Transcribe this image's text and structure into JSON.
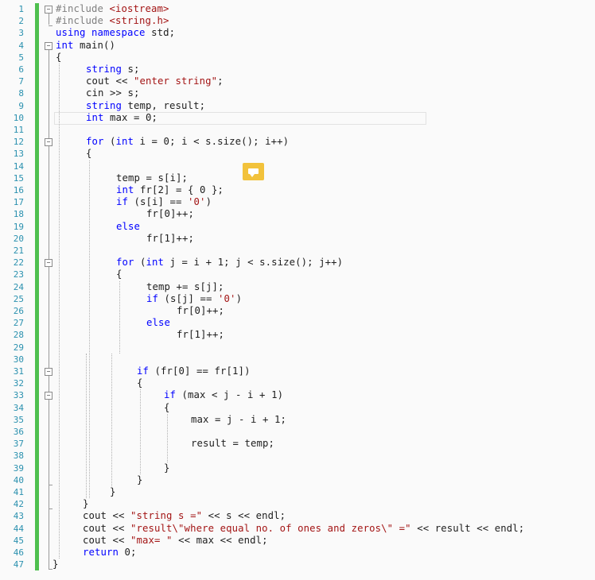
{
  "editor": {
    "line_numbers": [
      "1",
      "2",
      "3",
      "4",
      "5",
      "6",
      "7",
      "8",
      "9",
      "10",
      "11",
      "12",
      "13",
      "14",
      "15",
      "16",
      "17",
      "18",
      "19",
      "20",
      "21",
      "22",
      "23",
      "24",
      "25",
      "26",
      "27",
      "28",
      "29",
      "30",
      "31",
      "32",
      "33",
      "34",
      "35",
      "36",
      "37",
      "38",
      "39",
      "40",
      "41",
      "42",
      "43",
      "44",
      "45",
      "46",
      "47"
    ],
    "lines": [
      {
        "parts": [
          {
            "c": "inc",
            "t": "#include "
          },
          {
            "c": "str",
            "t": "<iostream>"
          }
        ]
      },
      {
        "parts": [
          {
            "c": "inc",
            "t": "#include "
          },
          {
            "c": "str",
            "t": "<string.h>"
          }
        ]
      },
      {
        "parts": [
          {
            "c": "kw",
            "t": "using namespace "
          },
          {
            "t": "std;"
          }
        ]
      },
      {
        "parts": [
          {
            "c": "kw",
            "t": "int "
          },
          {
            "t": "main()"
          }
        ]
      },
      {
        "parts": [
          {
            "t": "{"
          }
        ]
      },
      {
        "parts": [
          {
            "c": "kw",
            "t": "string "
          },
          {
            "t": "s;"
          }
        ]
      },
      {
        "parts": [
          {
            "t": "cout << "
          },
          {
            "c": "str",
            "t": "\"enter string\""
          },
          {
            "t": ";"
          }
        ]
      },
      {
        "parts": [
          {
            "t": "cin >> s;"
          }
        ]
      },
      {
        "parts": [
          {
            "c": "kw",
            "t": "string "
          },
          {
            "t": "temp, result;"
          }
        ]
      },
      {
        "parts": [
          {
            "c": "kw",
            "t": "int "
          },
          {
            "t": "max = 0;"
          }
        ]
      },
      {
        "parts": []
      },
      {
        "parts": [
          {
            "c": "kw",
            "t": "for "
          },
          {
            "t": "("
          },
          {
            "c": "kw",
            "t": "int "
          },
          {
            "t": "i = 0; i < s.size(); i++)"
          }
        ]
      },
      {
        "parts": [
          {
            "t": "{"
          }
        ]
      },
      {
        "parts": []
      },
      {
        "parts": [
          {
            "t": "temp = s[i];"
          }
        ]
      },
      {
        "parts": [
          {
            "c": "kw",
            "t": "int "
          },
          {
            "t": "fr[2] = { 0 };"
          }
        ]
      },
      {
        "parts": [
          {
            "c": "kw",
            "t": "if "
          },
          {
            "t": "(s[i] == "
          },
          {
            "c": "str",
            "t": "'0'"
          },
          {
            "t": ")"
          }
        ]
      },
      {
        "parts": [
          {
            "t": "fr[0]++;"
          }
        ]
      },
      {
        "parts": [
          {
            "c": "kw",
            "t": "else"
          }
        ]
      },
      {
        "parts": [
          {
            "t": "fr[1]++;"
          }
        ]
      },
      {
        "parts": []
      },
      {
        "parts": [
          {
            "c": "kw",
            "t": "for "
          },
          {
            "t": "("
          },
          {
            "c": "kw",
            "t": "int "
          },
          {
            "t": "j = i + 1; j < s.size(); j++)"
          }
        ]
      },
      {
        "parts": [
          {
            "t": "{"
          }
        ]
      },
      {
        "parts": [
          {
            "t": "temp += s[j];"
          }
        ]
      },
      {
        "parts": [
          {
            "c": "kw",
            "t": "if "
          },
          {
            "t": "(s[j] == "
          },
          {
            "c": "str",
            "t": "'0'"
          },
          {
            "t": ")"
          }
        ]
      },
      {
        "parts": [
          {
            "t": "fr[0]++;"
          }
        ]
      },
      {
        "parts": [
          {
            "c": "kw",
            "t": "else"
          }
        ]
      },
      {
        "parts": [
          {
            "t": "fr[1]++;"
          }
        ]
      },
      {
        "parts": []
      },
      {
        "parts": []
      },
      {
        "parts": [
          {
            "c": "kw",
            "t": "if "
          },
          {
            "t": "(fr[0] == fr[1])"
          }
        ]
      },
      {
        "parts": [
          {
            "t": "{"
          }
        ]
      },
      {
        "parts": [
          {
            "c": "kw",
            "t": "if "
          },
          {
            "t": "(max < j - i + 1)"
          }
        ]
      },
      {
        "parts": [
          {
            "t": "{"
          }
        ]
      },
      {
        "parts": [
          {
            "t": "max = j - i + 1;"
          }
        ]
      },
      {
        "parts": []
      },
      {
        "parts": [
          {
            "t": "result = temp;"
          }
        ]
      },
      {
        "parts": []
      },
      {
        "parts": [
          {
            "t": "}"
          }
        ]
      },
      {
        "parts": [
          {
            "t": "}"
          }
        ]
      },
      {
        "parts": [
          {
            "t": "}"
          }
        ]
      },
      {
        "parts": [
          {
            "t": "}"
          }
        ]
      },
      {
        "parts": [
          {
            "t": "cout << "
          },
          {
            "c": "str",
            "t": "\"string s =\""
          },
          {
            "t": " << s << endl;"
          }
        ]
      },
      {
        "parts": [
          {
            "t": "cout << "
          },
          {
            "c": "str",
            "t": "\"result\\\"where equal no. of ones and zeros\\\" =\""
          },
          {
            "t": " << result << endl;"
          }
        ]
      },
      {
        "parts": [
          {
            "t": "cout << "
          },
          {
            "c": "str",
            "t": "\"max= \""
          },
          {
            "t": " << max << endl;"
          }
        ]
      },
      {
        "parts": [
          {
            "c": "kw",
            "t": "return "
          },
          {
            "t": "0;"
          }
        ]
      },
      {
        "parts": [
          {
            "t": "}"
          }
        ]
      }
    ],
    "fold_markers": [
      {
        "line": 1,
        "state": "expanded"
      },
      {
        "line": 4,
        "state": "expanded"
      },
      {
        "line": 12,
        "state": "expanded"
      },
      {
        "line": 22,
        "state": "expanded"
      },
      {
        "line": 31,
        "state": "expanded"
      },
      {
        "line": 33,
        "state": "expanded"
      }
    ],
    "comment_glyph": "comment-icon",
    "colors": {
      "keyword": "#0000ff",
      "string": "#a31515",
      "preprocessor": "#808080",
      "line_number": "#2b91af",
      "change_bar": "#4fbf4f",
      "comment_glyph": "#f2c23b"
    }
  }
}
